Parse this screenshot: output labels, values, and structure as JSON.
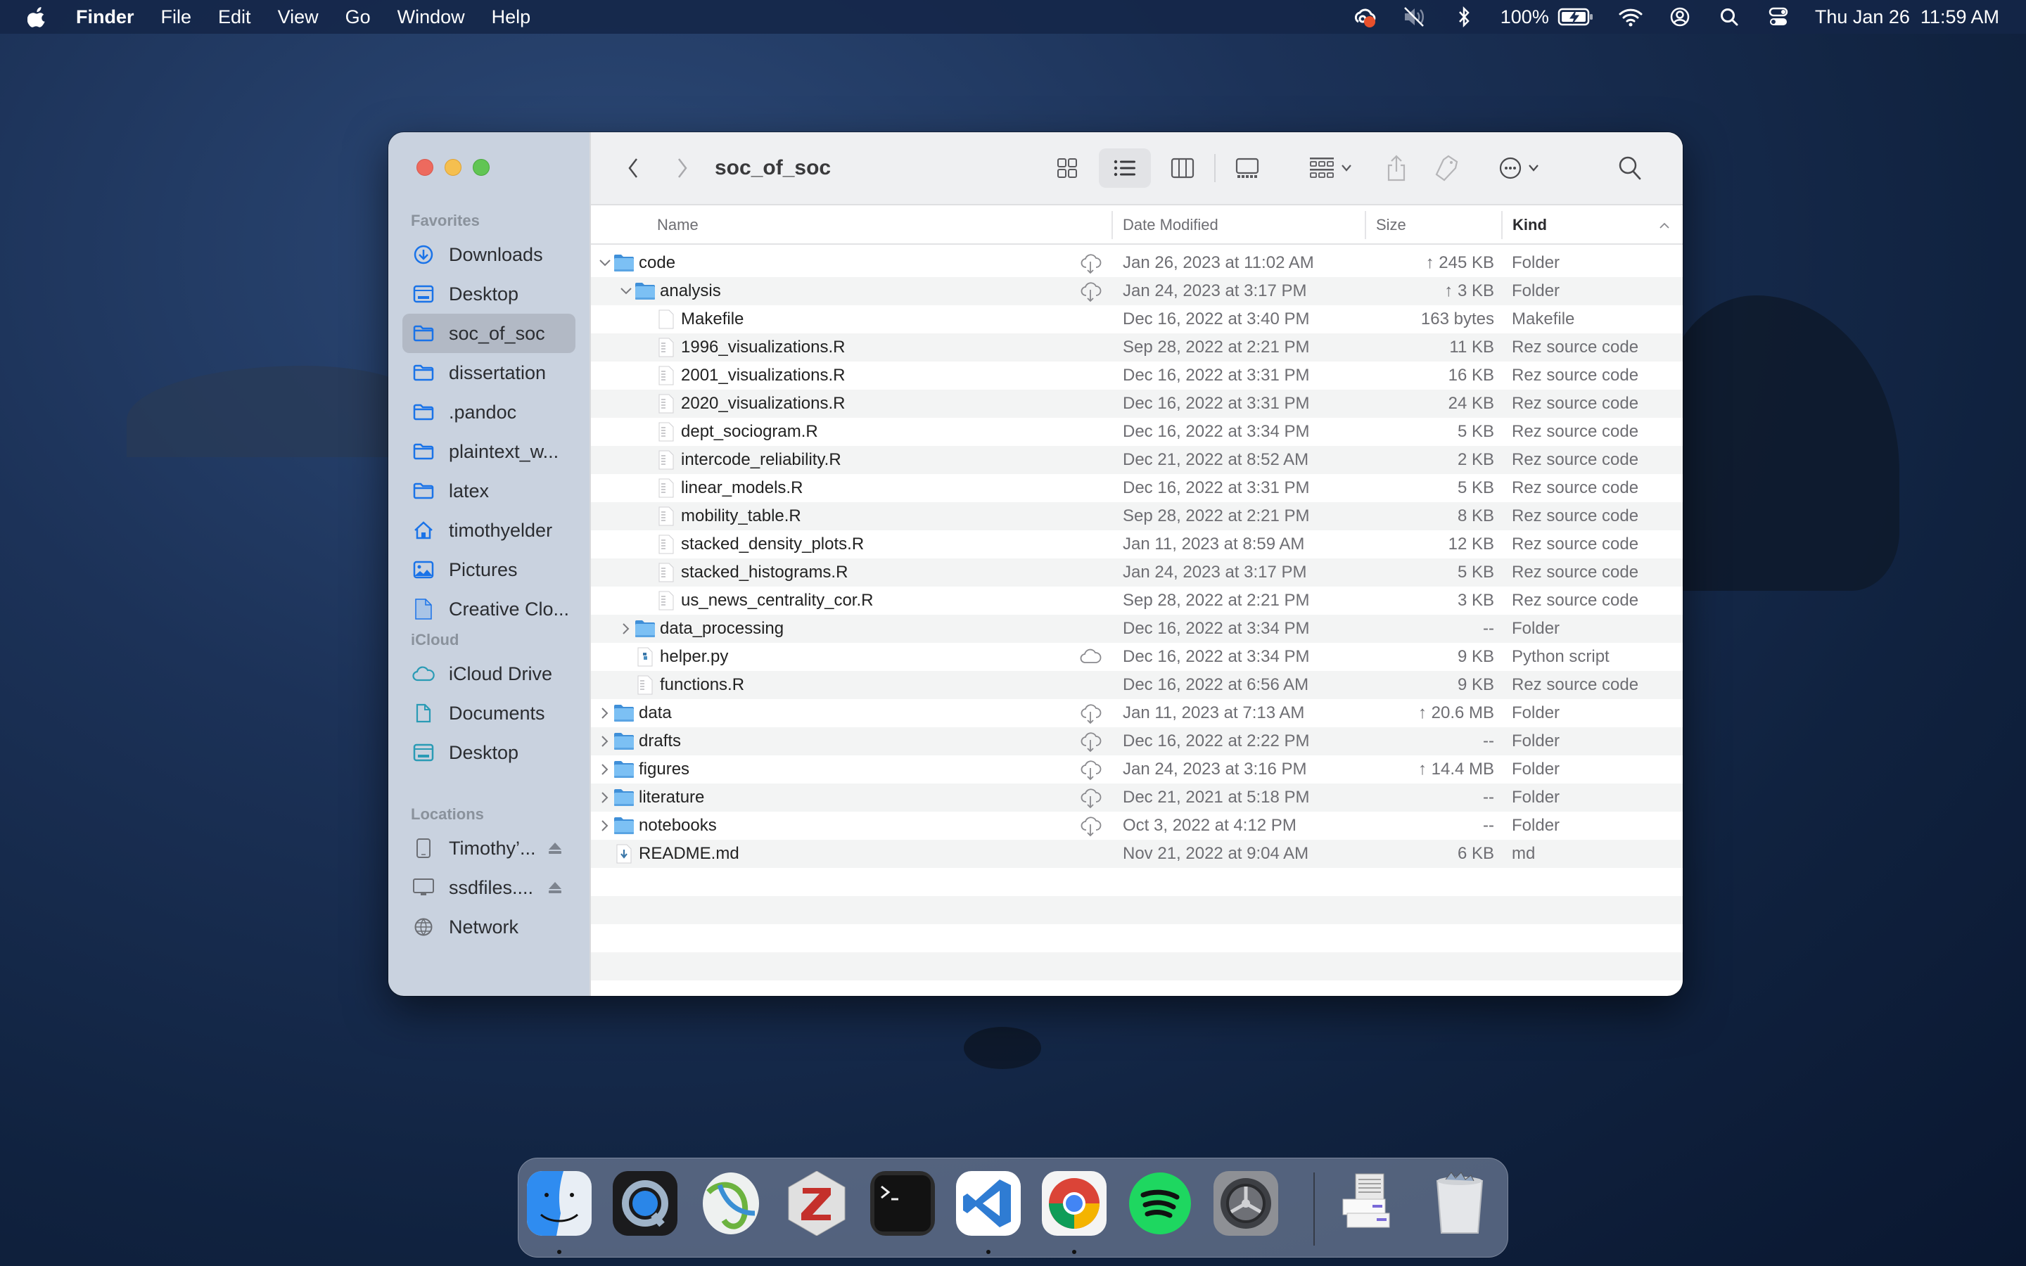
{
  "menubar": {
    "app_name": "Finder",
    "menus": [
      "File",
      "Edit",
      "View",
      "Go",
      "Window",
      "Help"
    ],
    "status_icons": [
      "creative-cloud-icon",
      "mute-icon",
      "bluetooth-icon",
      "battery-icon",
      "wifi-icon",
      "user-icon",
      "spotlight-icon",
      "control-center-icon"
    ],
    "battery_percent": "100%",
    "datetime": "Thu Jan 26  11:59 AM"
  },
  "window": {
    "title": "soc_of_soc",
    "sidebar": {
      "sections": [
        {
          "header": "Favorites",
          "items": [
            {
              "label": "Downloads",
              "icon": "downloads-icon"
            },
            {
              "label": "Desktop",
              "icon": "desktop-icon"
            },
            {
              "label": "soc_of_soc",
              "icon": "folder-icon",
              "selected": true
            },
            {
              "label": "dissertation",
              "icon": "folder-icon"
            },
            {
              "label": ".pandoc",
              "icon": "folder-icon"
            },
            {
              "label": "plaintext_w...",
              "icon": "folder-icon"
            },
            {
              "label": "latex",
              "icon": "folder-icon"
            },
            {
              "label": "timothyelder",
              "icon": "home-icon"
            },
            {
              "label": "Pictures",
              "icon": "pictures-icon"
            },
            {
              "label": "Creative Clo...",
              "icon": "document-icon"
            }
          ]
        },
        {
          "header": "iCloud",
          "items": [
            {
              "label": "iCloud Drive",
              "icon": "icloud-icon"
            },
            {
              "label": "Documents",
              "icon": "document-icon"
            },
            {
              "label": "Desktop",
              "icon": "desktop-icon"
            }
          ]
        },
        {
          "header": "Locations",
          "items": [
            {
              "label": "Timothy’...",
              "icon": "ipad-icon",
              "eject": true
            },
            {
              "label": "ssdfiles....",
              "icon": "display-icon",
              "eject": true
            },
            {
              "label": "Network",
              "icon": "network-icon"
            }
          ]
        }
      ]
    },
    "columns": {
      "name": "Name",
      "date": "Date Modified",
      "size": "Size",
      "kind": "Kind"
    },
    "sort_column": "Kind",
    "files": [
      {
        "name": "code",
        "depth": 0,
        "type": "folder",
        "disclosure": "open",
        "cloud": "download",
        "date": "Jan 26, 2023 at 11:02 AM",
        "size": "↑ 245 KB",
        "kind": "Folder"
      },
      {
        "name": "analysis",
        "depth": 1,
        "type": "folder",
        "disclosure": "open",
        "cloud": "download",
        "date": "Jan 24, 2023 at 3:17 PM",
        "size": "↑ 3 KB",
        "kind": "Folder"
      },
      {
        "name": "Makefile",
        "depth": 2,
        "type": "blank",
        "date": "Dec 16, 2022 at 3:40 PM",
        "size": "163 bytes",
        "kind": "Makefile"
      },
      {
        "name": "1996_visualizations.R",
        "depth": 2,
        "type": "text",
        "date": "Sep 28, 2022 at 2:21 PM",
        "size": "11 KB",
        "kind": "Rez source code"
      },
      {
        "name": "2001_visualizations.R",
        "depth": 2,
        "type": "text",
        "date": "Dec 16, 2022 at 3:31 PM",
        "size": "16 KB",
        "kind": "Rez source code"
      },
      {
        "name": "2020_visualizations.R",
        "depth": 2,
        "type": "text",
        "date": "Dec 16, 2022 at 3:31 PM",
        "size": "24 KB",
        "kind": "Rez source code"
      },
      {
        "name": "dept_sociogram.R",
        "depth": 2,
        "type": "text",
        "date": "Dec 16, 2022 at 3:34 PM",
        "size": "5 KB",
        "kind": "Rez source code"
      },
      {
        "name": "intercode_reliability.R",
        "depth": 2,
        "type": "text",
        "date": "Dec 21, 2022 at 8:52 AM",
        "size": "2 KB",
        "kind": "Rez source code"
      },
      {
        "name": "linear_models.R",
        "depth": 2,
        "type": "text",
        "date": "Dec 16, 2022 at 3:31 PM",
        "size": "5 KB",
        "kind": "Rez source code"
      },
      {
        "name": "mobility_table.R",
        "depth": 2,
        "type": "text",
        "date": "Sep 28, 2022 at 2:21 PM",
        "size": "8 KB",
        "kind": "Rez source code"
      },
      {
        "name": "stacked_density_plots.R",
        "depth": 2,
        "type": "text",
        "date": "Jan 11, 2023 at 8:59 AM",
        "size": "12 KB",
        "kind": "Rez source code"
      },
      {
        "name": "stacked_histograms.R",
        "depth": 2,
        "type": "text",
        "date": "Jan 24, 2023 at 3:17 PM",
        "size": "5 KB",
        "kind": "Rez source code"
      },
      {
        "name": "us_news_centrality_cor.R",
        "depth": 2,
        "type": "text",
        "date": "Sep 28, 2022 at 2:21 PM",
        "size": "3 KB",
        "kind": "Rez source code"
      },
      {
        "name": "data_processing",
        "depth": 1,
        "type": "folder",
        "disclosure": "closed",
        "date": "Dec 16, 2022 at 3:34 PM",
        "size": "--",
        "kind": "Folder"
      },
      {
        "name": "helper.py",
        "depth": 1,
        "type": "python",
        "cloud": "cloud",
        "date": "Dec 16, 2022 at 3:34 PM",
        "size": "9 KB",
        "kind": "Python script"
      },
      {
        "name": "functions.R",
        "depth": 1,
        "type": "text",
        "date": "Dec 16, 2022 at 6:56 AM",
        "size": "9 KB",
        "kind": "Rez source code"
      },
      {
        "name": "data",
        "depth": 0,
        "type": "folder",
        "disclosure": "closed",
        "cloud": "download",
        "date": "Jan 11, 2023 at 7:13 AM",
        "size": "↑ 20.6 MB",
        "kind": "Folder"
      },
      {
        "name": "drafts",
        "depth": 0,
        "type": "folder",
        "disclosure": "closed",
        "cloud": "download",
        "date": "Dec 16, 2022 at 2:22 PM",
        "size": "--",
        "kind": "Folder"
      },
      {
        "name": "figures",
        "depth": 0,
        "type": "folder",
        "disclosure": "closed",
        "cloud": "download",
        "date": "Jan 24, 2023 at 3:16 PM",
        "size": "↑ 14.4 MB",
        "kind": "Folder"
      },
      {
        "name": "literature",
        "depth": 0,
        "type": "folder",
        "disclosure": "closed",
        "cloud": "download",
        "date": "Dec 21, 2021 at 5:18 PM",
        "size": "--",
        "kind": "Folder"
      },
      {
        "name": "notebooks",
        "depth": 0,
        "type": "folder",
        "disclosure": "closed",
        "cloud": "download",
        "date": "Oct 3, 2022 at 4:12 PM",
        "size": "--",
        "kind": "Folder"
      },
      {
        "name": "README.md",
        "depth": 0,
        "type": "markdown",
        "date": "Nov 21, 2022 at 9:04 AM",
        "size": "6 KB",
        "kind": "md"
      }
    ],
    "empty_rows": 4
  },
  "dock": {
    "apps": [
      {
        "name": "Finder",
        "icon": "finder-icon",
        "running": true
      },
      {
        "name": "QuickTime Player",
        "icon": "quicktime-icon",
        "running": false
      },
      {
        "name": "Cisco AnyConnect",
        "icon": "anyconnect-icon",
        "running": false
      },
      {
        "name": "Zotero",
        "icon": "zotero-icon",
        "running": false
      },
      {
        "name": "Terminal",
        "icon": "terminal-icon",
        "running": false
      },
      {
        "name": "Visual Studio Code",
        "icon": "vscode-icon",
        "running": true
      },
      {
        "name": "Google Chrome",
        "icon": "chrome-icon",
        "running": true
      },
      {
        "name": "Spotify",
        "icon": "spotify-icon",
        "running": false
      },
      {
        "name": "System Preferences",
        "icon": "system-preferences-icon",
        "running": false
      }
    ],
    "others": [
      {
        "name": "Downloads stack",
        "icon": "downloads-stack-icon"
      },
      {
        "name": "Trash",
        "icon": "trash-icon"
      }
    ]
  },
  "colors": {
    "accent": "#1a73e8",
    "sidebar_bg": "#c9d2df",
    "selected_bg": "#b2b9c5",
    "folder_blue": "#6fb7ef",
    "close": "#ed6a5e",
    "minimize": "#f5bf4f",
    "zoom": "#61c554"
  }
}
